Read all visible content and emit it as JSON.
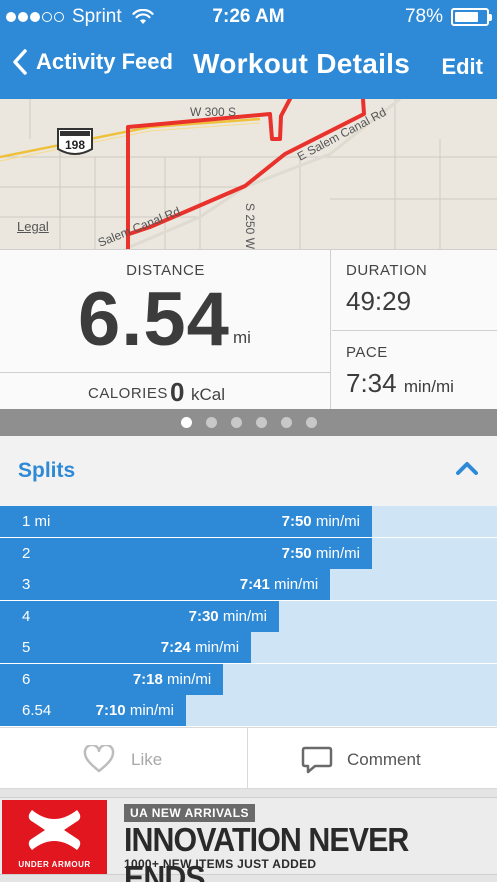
{
  "status_bar": {
    "carrier": "Sprint",
    "time": "7:26 AM",
    "battery": "78%",
    "battery_level": 0.78,
    "signal_bars": 3,
    "signal_total": 5
  },
  "nav": {
    "back_label": "Activity Feed",
    "title": "Workout Details",
    "edit_label": "Edit"
  },
  "map": {
    "legal_label": "Legal",
    "route_shield": "198",
    "road_labels": [
      "W 300 S",
      "E Salem Canal Rd",
      "S 250 W",
      "Salem Canal Rd"
    ],
    "route_color": "#e8322b"
  },
  "stats": {
    "distance_label": "DISTANCE",
    "distance_value": "6.54",
    "distance_unit": "mi",
    "calories_label": "CALORIES",
    "calories_value": "0",
    "calories_unit": "kCal",
    "duration_label": "DURATION",
    "duration_value": "49:29",
    "pace_label": "PACE",
    "pace_value": "7:34",
    "pace_unit": "min/mi"
  },
  "pager": {
    "pages": 6,
    "active_index": 0
  },
  "splits": {
    "title": "Splits",
    "unit": "min/mi",
    "rows": [
      {
        "label": "1 mi",
        "pace": "7:50",
        "seconds": 470
      },
      {
        "label": "2",
        "pace": "7:50",
        "seconds": 470
      },
      {
        "label": "3",
        "pace": "7:41",
        "seconds": 461
      },
      {
        "label": "4",
        "pace": "7:30",
        "seconds": 450
      },
      {
        "label": "5",
        "pace": "7:24",
        "seconds": 444
      },
      {
        "label": "6",
        "pace": "7:18",
        "seconds": 438
      },
      {
        "label": "6.54",
        "pace": "7:10",
        "seconds": 430
      }
    ]
  },
  "actions": {
    "like_label": "Like",
    "comment_label": "Comment"
  },
  "ad": {
    "brand": "UNDER ARMOUR",
    "tag": "UA NEW ARRIVALS",
    "headline": "INNOVATION NEVER ENDS.",
    "subline": "1000+ NEW ITEMS JUST ADDED"
  },
  "colors": {
    "accent": "#2e8ad6",
    "split_track": "#cfe4f4",
    "ad_red": "#e2161f"
  }
}
